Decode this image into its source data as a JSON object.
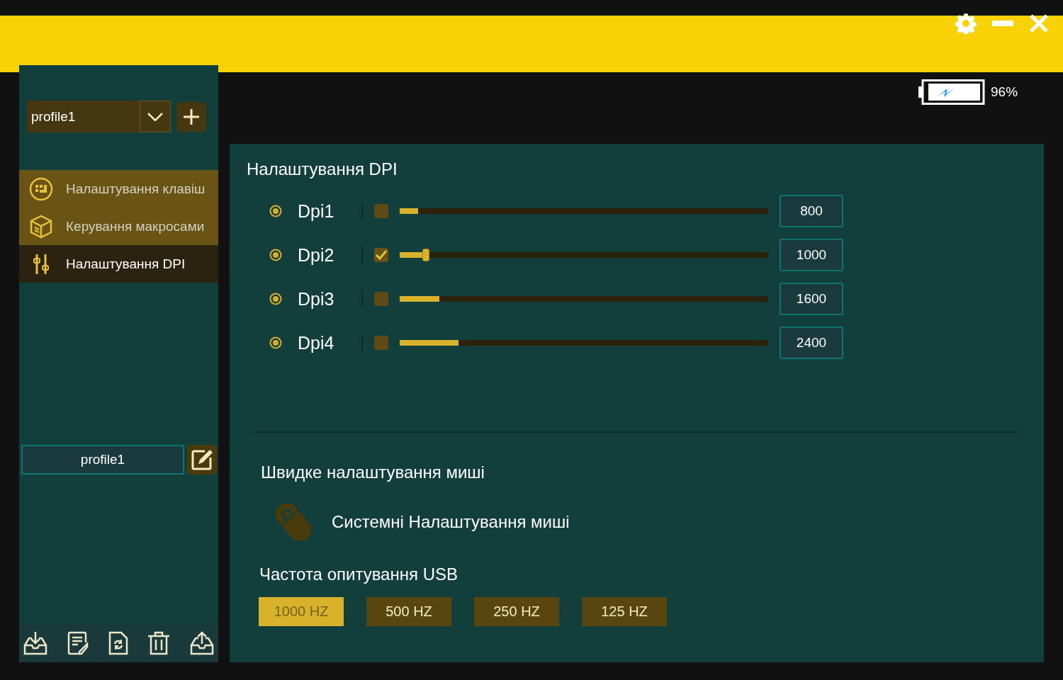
{
  "battery": {
    "reading": "96%"
  },
  "profile_select": {
    "value": "profile1"
  },
  "nav": [
    {
      "label": "Налаштування клавіш",
      "selected": false
    },
    {
      "label": "Керування макросами",
      "selected": false
    },
    {
      "label": "Налаштування DPI",
      "selected": true
    }
  ],
  "profile_name": {
    "value": "profile1"
  },
  "dpi": {
    "title": "Налаштування DPI",
    "rows": [
      {
        "label": "Dpi1",
        "checked": false,
        "level": 0.05,
        "value": "800"
      },
      {
        "label": "Dpi2",
        "checked": true,
        "level": 0.073,
        "value": "1000"
      },
      {
        "label": "Dpi3",
        "checked": false,
        "level": 0.108,
        "value": "1600"
      },
      {
        "label": "Dpi4",
        "checked": false,
        "level": 0.16,
        "value": "2400"
      }
    ]
  },
  "quick": {
    "title": "Швидке налаштування миші",
    "system_link": "Системні Налаштування миші"
  },
  "usb": {
    "title": "Частота опитування USB",
    "rates": [
      {
        "label": "1000 HZ",
        "selected": true
      },
      {
        "label": "500 HZ",
        "selected": false
      },
      {
        "label": "250 HZ",
        "selected": false
      },
      {
        "label": "125 HZ",
        "selected": false
      }
    ]
  }
}
